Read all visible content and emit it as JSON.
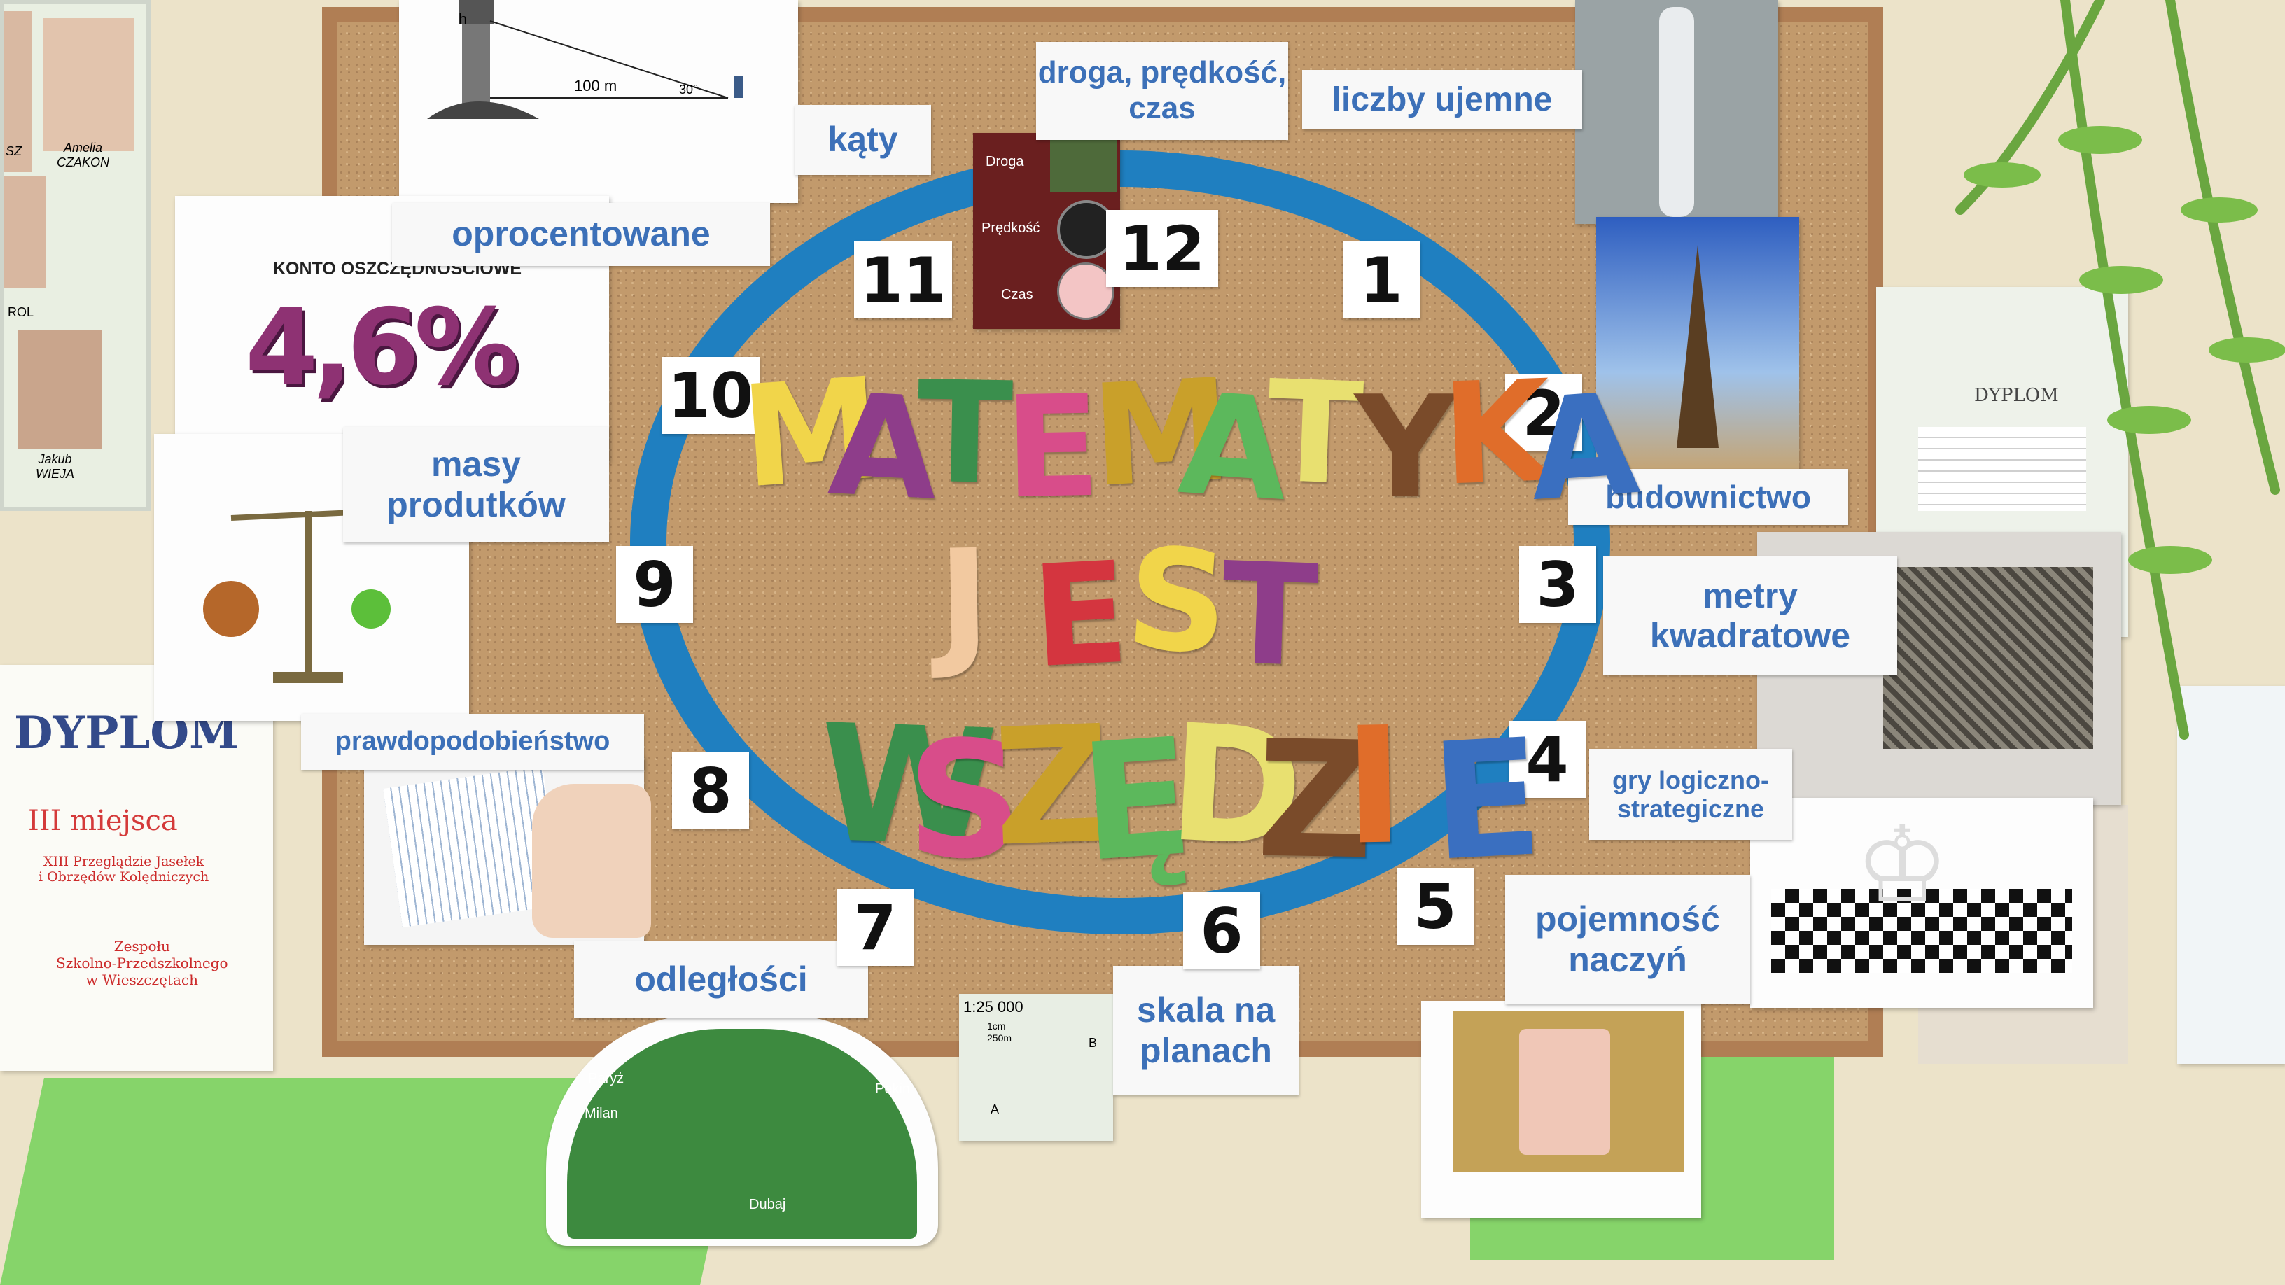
{
  "title_words": [
    "MATEMATYKA",
    "JEST",
    "WSZĘDZIE"
  ],
  "title_colors": [
    "#f1d54a",
    "#8e3d8a",
    "#3a8f4d",
    "#d84d8a",
    "#c9a02a",
    "#5cb85c",
    "#e8e070",
    "#7a4b2a",
    "#e06d2a",
    "#3a6fc0",
    "#f2c9a0",
    "#d4353f"
  ],
  "accent_colors": {
    "ring": "#1f7fc0",
    "wall_green": "#86d46a",
    "label_blue": "#3c70b8"
  },
  "clock_numbers": [
    "1",
    "2",
    "3",
    "4",
    "5",
    "6",
    "7",
    "8",
    "9",
    "10",
    "11",
    "12"
  ],
  "labels": {
    "katy": "kąty",
    "droga": "droga, prędkość,\nczas",
    "liczby": "liczby ujemne",
    "oprocentowane": "oprocentowane",
    "budownictwo": "budownictwo",
    "masy": "masy\nprodutków",
    "metry": "metry\nkwadratowe",
    "prawdopodobienstwo": "prawdopodobieństwo",
    "gry": "gry logiczno-\nstrategiczne",
    "pojemnosc": "pojemność\nnaczyń",
    "odleglosci": "odległości",
    "skala": "skala na\nplanach"
  },
  "lighthouse": {
    "h": "h",
    "distance": "100 m",
    "angle": "30°"
  },
  "savings": {
    "heading": "KONTO OSZCZĘDNOŚCIOWE",
    "rate": "4,6%"
  },
  "speed_card": {
    "droga": "Droga",
    "predkosc": "Prędkość",
    "czas": "Czas"
  },
  "map": {
    "scale": "1:25 000",
    "scale_bar_a": "1cm",
    "scale_bar_b": "250m",
    "point_a": "A",
    "point_b": "B"
  },
  "globe": {
    "paryz": "Paryż",
    "milan": "Milan",
    "dubaj": "Dubaj",
    "pekin": "Pekin"
  },
  "photos_left": {
    "name1": "Amelia\nCZAKON",
    "name2": "Jakub\nWIEJA",
    "partial1": "SZ",
    "partial2": "ROL"
  },
  "diploma_left": {
    "title": "DYPLOM",
    "place": "III miejsca",
    "text": "XIII Przeglądzie Jasełek\ni Obrzędów Kolędniczych",
    "school": "Zespołu\nSzkolno-Przedszkolnego\nw Wieszczętach"
  },
  "diploma_right": {
    "title": "DYPLOM"
  }
}
